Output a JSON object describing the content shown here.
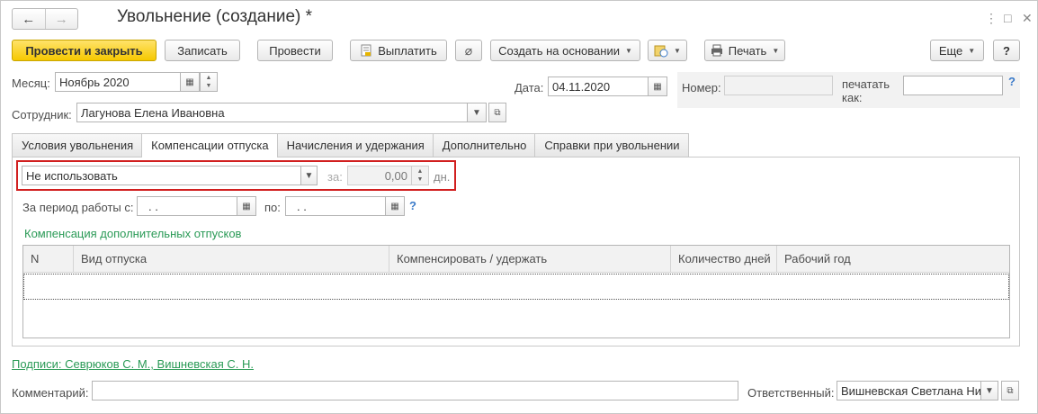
{
  "window": {
    "title": "Увольнение (создание) *",
    "nav_back": "←",
    "nav_forward": "→",
    "more_dots": "⋮",
    "maximize": "□",
    "close": "✕"
  },
  "toolbar": {
    "post_and_close": "Провести и закрыть",
    "save": "Записать",
    "post": "Провести",
    "pay": "Выплатить",
    "create_based_on": "Создать на основании",
    "print": "Печать",
    "more": "Еще",
    "help": "?"
  },
  "header": {
    "month_label": "Месяц:",
    "month_value": "Ноябрь 2020",
    "date_label": "Дата:",
    "date_value": "04.11.2020",
    "number_label": "Номер:",
    "number_value": "",
    "print_as_label": "печатать как:",
    "print_as_value": "",
    "employee_label": "Сотрудник:",
    "employee_value": "Лагунова Елена Ивановна",
    "help": "?"
  },
  "tabs": [
    {
      "label": "Условия увольнения",
      "active": false
    },
    {
      "label": "Компенсации отпуска",
      "active": true
    },
    {
      "label": "Начисления и удержания",
      "active": false
    },
    {
      "label": "Дополнительно",
      "active": false
    },
    {
      "label": "Справки при увольнении",
      "active": false
    }
  ],
  "compensation": {
    "mode_value": "Не использовать",
    "for_label": "за:",
    "days_value": "0,00",
    "days_unit": "дн.",
    "period_label": "За период работы с:",
    "period_from": ".  .",
    "period_to_label": "по:",
    "period_to": ".  .",
    "help": "?",
    "section_title": "Компенсация дополнительных отпусков",
    "table_columns": [
      "N",
      "Вид отпуска",
      "Компенсировать / удержать",
      "Количество дней",
      "Рабочий год"
    ],
    "table_rows": []
  },
  "footer": {
    "signatures_link": "Подписи: Севрюков С. М., Вишневская С. Н.",
    "comment_label": "Комментарий:",
    "comment_value": "",
    "responsible_label": "Ответственный:",
    "responsible_value": "Вишневская Светлана Ни"
  },
  "colors": {
    "primary_button": "#f6c800",
    "highlight_border": "#d11f1f",
    "link_green": "#2a9a56",
    "help_blue": "#3a7ac9"
  }
}
